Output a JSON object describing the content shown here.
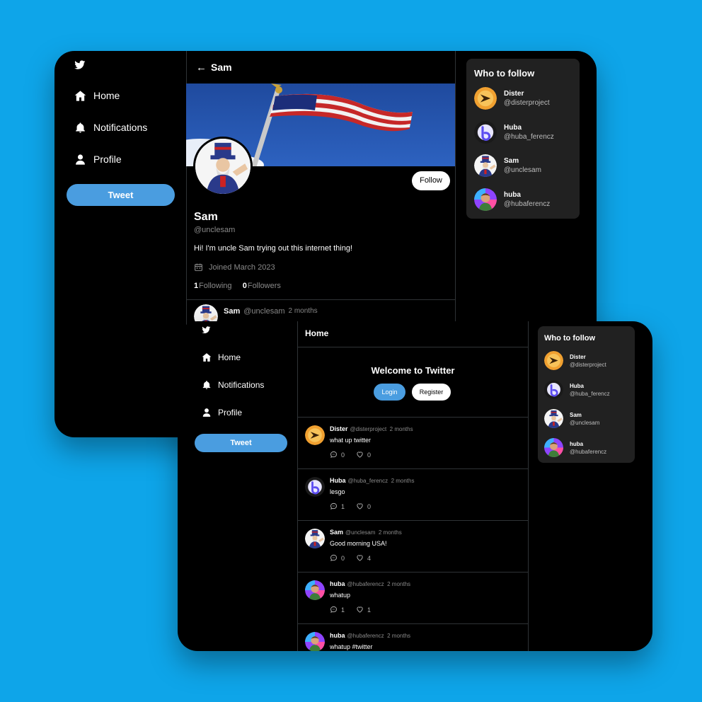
{
  "back_window": {
    "nav": [
      {
        "label": "Home",
        "icon": "home-icon"
      },
      {
        "label": "Notifications",
        "icon": "bell-icon"
      },
      {
        "label": "Profile",
        "icon": "user-icon"
      }
    ],
    "tweet_button": "Tweet",
    "profile": {
      "header_arrow": "←",
      "header_title": "Sam",
      "follow_label": "Follow",
      "name": "Sam",
      "handle": "@unclesam",
      "bio": "Hi! I'm uncle Sam trying out this internet thing!",
      "joined": "Joined March 2023",
      "following_count": "1",
      "following_label": "Following",
      "followers_count": "0",
      "followers_label": "Followers"
    },
    "peek_tweet": {
      "name": "Sam",
      "handle": "@unclesam",
      "time": "2 months"
    },
    "who_to_follow": {
      "title": "Who to follow",
      "users": [
        {
          "name": "Dister",
          "handle": "@disterproject"
        },
        {
          "name": "Huba",
          "handle": "@huba_ferencz"
        },
        {
          "name": "Sam",
          "handle": "@unclesam"
        },
        {
          "name": "huba",
          "handle": "@hubaferencz"
        }
      ]
    }
  },
  "front_window": {
    "nav": [
      {
        "label": "Home",
        "icon": "home-icon"
      },
      {
        "label": "Notifications",
        "icon": "bell-icon"
      },
      {
        "label": "Profile",
        "icon": "user-icon"
      }
    ],
    "tweet_button": "Tweet",
    "header_title": "Home",
    "welcome": {
      "title": "Welcome to Twitter",
      "login": "Login",
      "register": "Register"
    },
    "feed": [
      {
        "name": "Dister",
        "handle": "@disterproject",
        "time": "2 months",
        "text": "what up twitter",
        "replies": "0",
        "likes": "0"
      },
      {
        "name": "Huba",
        "handle": "@huba_ferencz",
        "time": "2 months",
        "text": "lesgo",
        "replies": "1",
        "likes": "0"
      },
      {
        "name": "Sam",
        "handle": "@unclesam",
        "time": "2 months",
        "text": "Good morning USA!",
        "replies": "0",
        "likes": "4"
      },
      {
        "name": "huba",
        "handle": "@hubaferencz",
        "time": "2 months",
        "text": "whatup",
        "replies": "1",
        "likes": "1"
      },
      {
        "name": "huba",
        "handle": "@hubaferencz",
        "time": "2 months",
        "text": "whatup #twitter",
        "replies": "",
        "likes": ""
      }
    ],
    "who_to_follow": {
      "title": "Who to follow",
      "users": [
        {
          "name": "Dister",
          "handle": "@disterproject"
        },
        {
          "name": "Huba",
          "handle": "@huba_ferencz"
        },
        {
          "name": "Sam",
          "handle": "@unclesam"
        },
        {
          "name": "huba",
          "handle": "@hubaferencz"
        }
      ]
    }
  },
  "colors": {
    "background": "#0ea5e9",
    "accent": "#4a9de0",
    "card": "#212121"
  }
}
